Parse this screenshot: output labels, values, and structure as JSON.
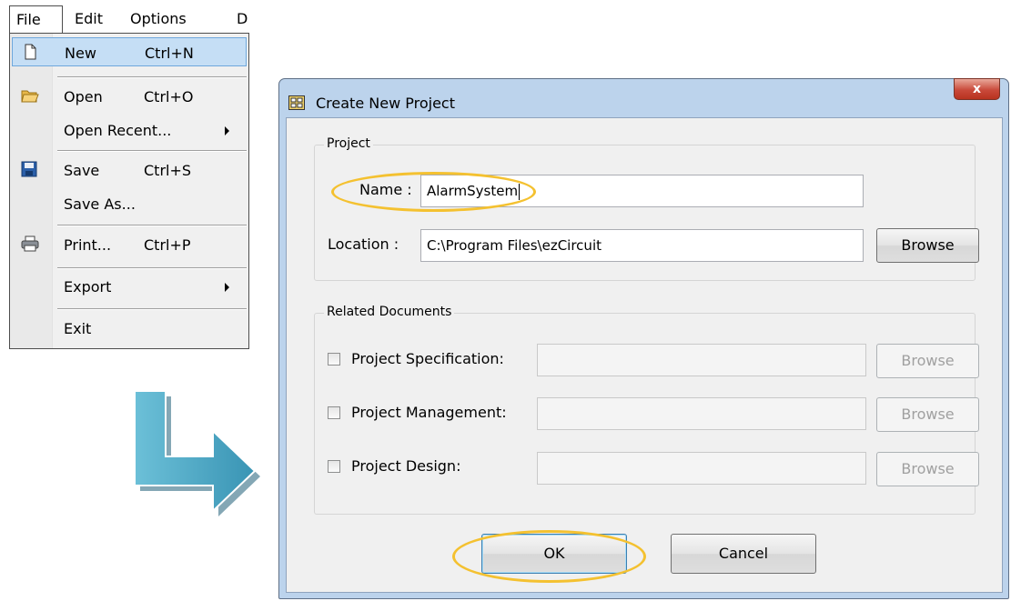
{
  "menubar": {
    "items": [
      "File",
      "Edit",
      "Options",
      "D"
    ]
  },
  "file_menu": {
    "items": [
      {
        "label": "New",
        "shortcut": "Ctrl+N"
      },
      {
        "label": "Open",
        "shortcut": "Ctrl+O"
      },
      {
        "label": "Open Recent...",
        "shortcut": ""
      },
      {
        "label": "Save",
        "shortcut": "Ctrl+S"
      },
      {
        "label": "Save As...",
        "shortcut": ""
      },
      {
        "label": "Print...",
        "shortcut": "Ctrl+P"
      },
      {
        "label": "Export",
        "shortcut": ""
      },
      {
        "label": "Exit",
        "shortcut": ""
      }
    ]
  },
  "dialog": {
    "title": "Create New Project",
    "close_glyph": "x",
    "project_group": {
      "title": "Project",
      "name_label": "Name :",
      "name_value": "AlarmSystem",
      "location_label": "Location :",
      "location_value": "C:\\Program Files\\ezCircuit",
      "browse_label": "Browse"
    },
    "related_group": {
      "title": "Related Documents",
      "rows": [
        {
          "label": "Project Specification:",
          "checked": false,
          "value": "",
          "browse": "Browse"
        },
        {
          "label": "Project Management:",
          "checked": false,
          "value": "",
          "browse": "Browse"
        },
        {
          "label": "Project Design:",
          "checked": false,
          "value": "",
          "browse": "Browse"
        }
      ]
    },
    "ok_label": "OK",
    "cancel_label": "Cancel"
  },
  "colors": {
    "highlight_ring": "#f4c130",
    "arrow": "#4aa7c4",
    "menu_selection": "#c5def5",
    "title_bar": "#bcd3ec",
    "close_button": "#c9493a"
  }
}
